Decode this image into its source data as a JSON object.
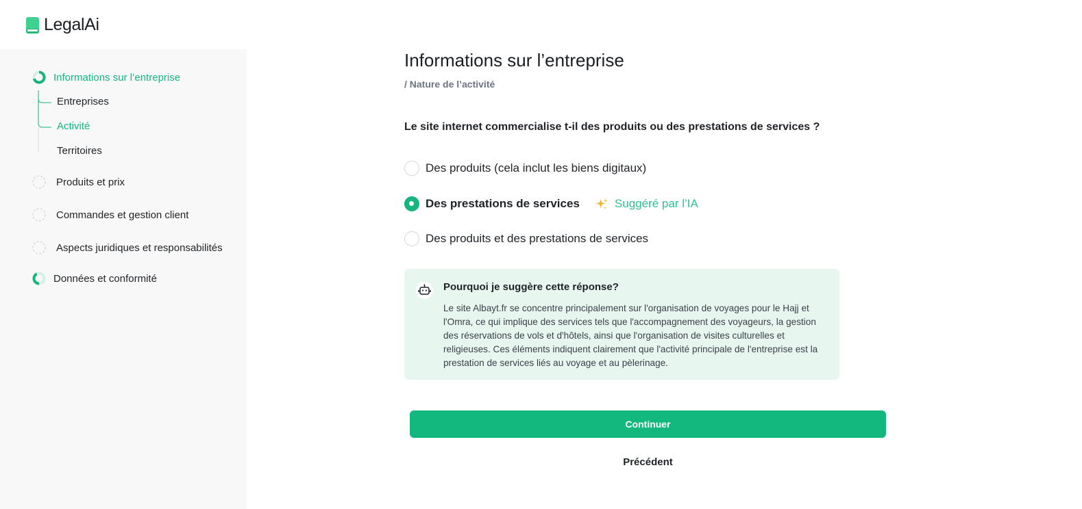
{
  "app": {
    "name": "LegalAi",
    "brand_color": "#16b47f"
  },
  "sidebar": {
    "steps": [
      {
        "label": "Informations sur l’entreprise",
        "state": "active"
      },
      {
        "label": "Produits et prix",
        "state": "pending"
      },
      {
        "label": "Commandes et gestion client",
        "state": "pending"
      },
      {
        "label": "Aspects juridiques et responsabilités",
        "state": "pending"
      },
      {
        "label": "Données et conformité",
        "state": "partial"
      }
    ],
    "substeps": [
      {
        "label": "Entreprises",
        "state": "done"
      },
      {
        "label": "Activité",
        "state": "active"
      },
      {
        "label": "Territoires",
        "state": "upcoming"
      }
    ]
  },
  "main": {
    "title": "Informations sur l’entreprise",
    "breadcrumb": "/ Nature de l’activité",
    "question": "Le site internet commercialise t-il des produits ou des prestations de services ?",
    "options": [
      {
        "label": "Des produits (cela inclut les biens digitaux)",
        "selected": false
      },
      {
        "label": "Des prestations de services",
        "selected": true,
        "badge": "Suggéré par l’IA",
        "badge_icon": "sparkles-icon"
      },
      {
        "label": "Des produits et des prestations de services",
        "selected": false
      }
    ],
    "explanation": {
      "icon": "robot-icon",
      "title": "Pourquoi je suggère cette réponse?",
      "body": "Le site Albayt.fr se concentre principalement sur l'organisation de voyages pour le Hajj et l'Omra, ce qui implique des services tels que l'accompagnement des voyageurs, la gestion des réservations de vols et d'hôtels, ainsi que l'organisation de visites culturelles et religieuses. Ces éléments indiquent clairement que l'activité principale de l'entreprise est la prestation de services liés au voyage et au pèlerinage."
    },
    "actions": {
      "continue_label": "Continuer",
      "previous_label": "Précédent"
    }
  }
}
